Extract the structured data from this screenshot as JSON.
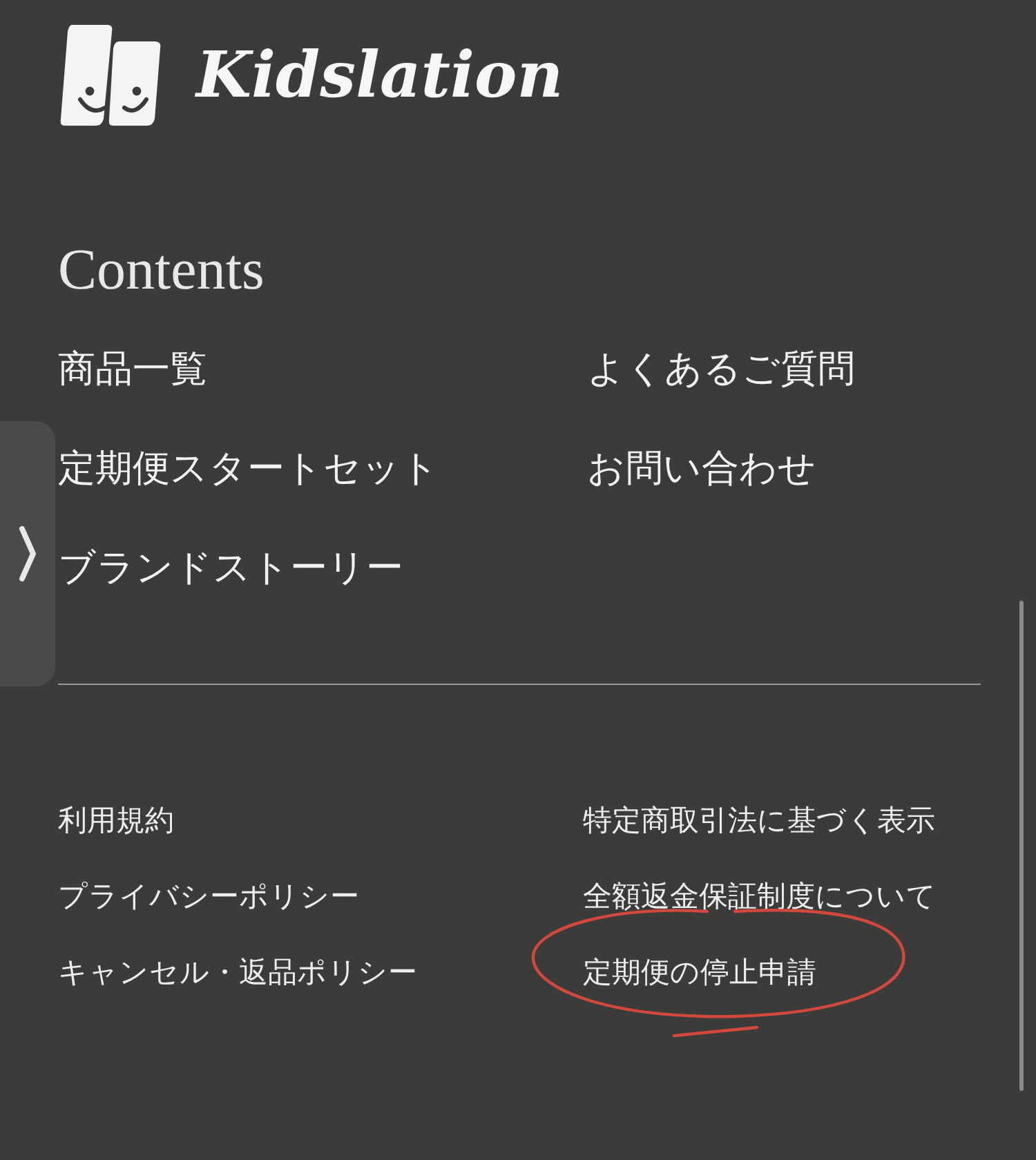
{
  "brand": {
    "name": "Kidslation"
  },
  "contents": {
    "heading": "Contents",
    "links": [
      {
        "label": "商品一覧"
      },
      {
        "label": "よくあるご質問"
      },
      {
        "label": "定期便スタートセット"
      },
      {
        "label": "お問い合わせ"
      },
      {
        "label": "ブランドストーリー"
      }
    ]
  },
  "footer_links": [
    {
      "label": "利用規約",
      "circled": false
    },
    {
      "label": "特定商取引法に基づく表示",
      "circled": false
    },
    {
      "label": "プライバシーポリシー",
      "circled": false
    },
    {
      "label": "全額返金保証制度について",
      "circled": false
    },
    {
      "label": "キャンセル・返品ポリシー",
      "circled": false
    },
    {
      "label": "定期便の停止申請",
      "circled": true
    }
  ]
}
